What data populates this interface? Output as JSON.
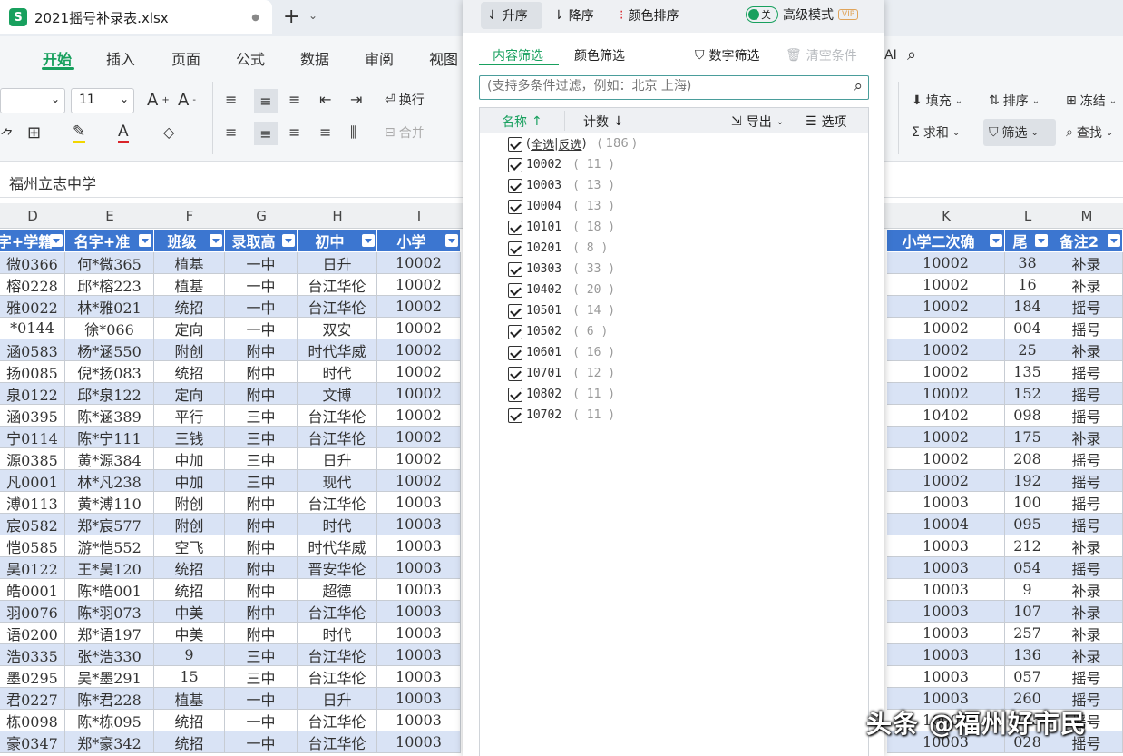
{
  "window": {
    "file_name": "2021摇号补录表.xlsx",
    "logo": "S",
    "close": "●",
    "new_tab": "+",
    "new_tab_arrow": "⌄"
  },
  "menu": [
    "开始",
    "插入",
    "页面",
    "公式",
    "数据",
    "审阅",
    "视图"
  ],
  "menu_active": "开始",
  "menu_right": "AI",
  "ribbon": {
    "font_size": "11",
    "wrap": "换行",
    "merge": "合并",
    "fill": "填充",
    "sort": "排序",
    "freeze": "冻结",
    "sum": "求和",
    "filter": "筛选",
    "find": "查找"
  },
  "formula": "福州立志中学",
  "columns_left": [
    "D",
    "E",
    "F",
    "G",
    "H",
    "I"
  ],
  "columns_right": [
    "K",
    "L",
    "M"
  ],
  "headers_left": [
    "字+学籍",
    "名字+准",
    "班级",
    "录取高",
    "初中",
    "小学"
  ],
  "headers_right": [
    "小学二次确",
    "尾",
    "备注2"
  ],
  "rows_left": [
    [
      "微0366",
      "何*微365",
      "植基",
      "一中",
      "日升",
      "10002"
    ],
    [
      "榕0228",
      "邱*榕223",
      "植基",
      "一中",
      "台江华伦",
      "10002"
    ],
    [
      "雅0022",
      "林*雅021",
      "统招",
      "一中",
      "台江华伦",
      "10002"
    ],
    [
      "*0144",
      "徐*066",
      "定向",
      "一中",
      "双安",
      "10002"
    ],
    [
      "涵0583",
      "杨*涵550",
      "附创",
      "附中",
      "时代华威",
      "10002"
    ],
    [
      "扬0085",
      "倪*扬083",
      "统招",
      "附中",
      "时代",
      "10002"
    ],
    [
      "泉0122",
      "邱*泉122",
      "定向",
      "附中",
      "文博",
      "10002"
    ],
    [
      "涵0395",
      "陈*涵389",
      "平行",
      "三中",
      "台江华伦",
      "10002"
    ],
    [
      "宁0114",
      "陈*宁111",
      "三钱",
      "三中",
      "台江华伦",
      "10002"
    ],
    [
      "源0385",
      "黄*源384",
      "中加",
      "三中",
      "日升",
      "10002"
    ],
    [
      "凡0001",
      "林*凡238",
      "中加",
      "三中",
      "现代",
      "10002"
    ],
    [
      "溥0113",
      "黄*溥110",
      "附创",
      "附中",
      "台江华伦",
      "10003"
    ],
    [
      "宸0582",
      "郑*宸577",
      "附创",
      "附中",
      "时代",
      "10003"
    ],
    [
      "恺0585",
      "游*恺552",
      "空飞",
      "附中",
      "时代华威",
      "10003"
    ],
    [
      "昊0122",
      "王*昊120",
      "统招",
      "附中",
      "晋安华伦",
      "10003"
    ],
    [
      "皓0001",
      "陈*皓001",
      "统招",
      "附中",
      "超德",
      "10003"
    ],
    [
      "羽0076",
      "陈*羽073",
      "中美",
      "附中",
      "台江华伦",
      "10003"
    ],
    [
      "语0200",
      "郑*语197",
      "中美",
      "附中",
      "时代",
      "10003"
    ],
    [
      "浩0335",
      "张*浩330",
      "9",
      "三中",
      "台江华伦",
      "10003"
    ],
    [
      "墨0295",
      "吴*墨291",
      "15",
      "三中",
      "台江华伦",
      "10003"
    ],
    [
      "君0227",
      "陈*君228",
      "植基",
      "一中",
      "日升",
      "10003"
    ],
    [
      "栋0098",
      "陈*栋095",
      "统招",
      "一中",
      "台江华伦",
      "10003"
    ],
    [
      "豪0347",
      "郑*豪342",
      "统招",
      "一中",
      "台江华伦",
      "10003"
    ]
  ],
  "rows_right": [
    [
      "10002",
      "38",
      "补录"
    ],
    [
      "10002",
      "16",
      "补录"
    ],
    [
      "10002",
      "184",
      "摇号"
    ],
    [
      "10002",
      "004",
      "摇号"
    ],
    [
      "10002",
      "25",
      "补录"
    ],
    [
      "10002",
      "135",
      "摇号"
    ],
    [
      "10002",
      "152",
      "摇号"
    ],
    [
      "10402",
      "098",
      "摇号"
    ],
    [
      "10002",
      "175",
      "补录"
    ],
    [
      "10002",
      "208",
      "摇号"
    ],
    [
      "10002",
      "192",
      "摇号"
    ],
    [
      "10003",
      "100",
      "摇号"
    ],
    [
      "10004",
      "095",
      "摇号"
    ],
    [
      "10003",
      "212",
      "补录"
    ],
    [
      "10003",
      "054",
      "摇号"
    ],
    [
      "10003",
      "9",
      "补录"
    ],
    [
      "10003",
      "107",
      "补录"
    ],
    [
      "10003",
      "257",
      "补录"
    ],
    [
      "10003",
      "136",
      "补录"
    ],
    [
      "10003",
      "057",
      "摇号"
    ],
    [
      "10003",
      "260",
      "摇号"
    ],
    [
      "10003",
      "255",
      "摇号"
    ],
    [
      "10003",
      "028",
      "摇号"
    ]
  ],
  "filter_panel": {
    "asc": "升序",
    "desc": "降序",
    "color_sort": "颜色排序",
    "toggle": "关",
    "advanced": "高级模式",
    "vip": "VIP",
    "tab_content": "内容筛选",
    "tab_color": "颜色筛选",
    "number_filter": "数字筛选",
    "clear": "清空条件",
    "search_placeholder": "(支持多条件过滤，例如：北京 上海)",
    "col_name": "名称",
    "col_count": "计数",
    "export": "导出",
    "options": "选项",
    "select_all": "全选",
    "invert": "反选",
    "total": "( 186 )",
    "items": [
      {
        "name": "10002",
        "count": "( 11 )"
      },
      {
        "name": "10003",
        "count": "( 13 )"
      },
      {
        "name": "10004",
        "count": "( 13 )"
      },
      {
        "name": "10101",
        "count": "( 18 )"
      },
      {
        "name": "10201",
        "count": "( 8 )"
      },
      {
        "name": "10303",
        "count": "( 33 )"
      },
      {
        "name": "10402",
        "count": "( 20 )"
      },
      {
        "name": "10501",
        "count": "( 14 )"
      },
      {
        "name": "10502",
        "count": "( 6 )"
      },
      {
        "name": "10601",
        "count": "( 16 )"
      },
      {
        "name": "10701",
        "count": "( 12 )"
      },
      {
        "name": "10802",
        "count": "( 11 )"
      },
      {
        "name": "10702",
        "count": "( 11 )"
      }
    ]
  },
  "watermark": "头条 @福州好市民",
  "colors": {
    "green": "#18a05e",
    "header_blue": "#3c76d0",
    "alt_row": "#d9e3f5"
  }
}
